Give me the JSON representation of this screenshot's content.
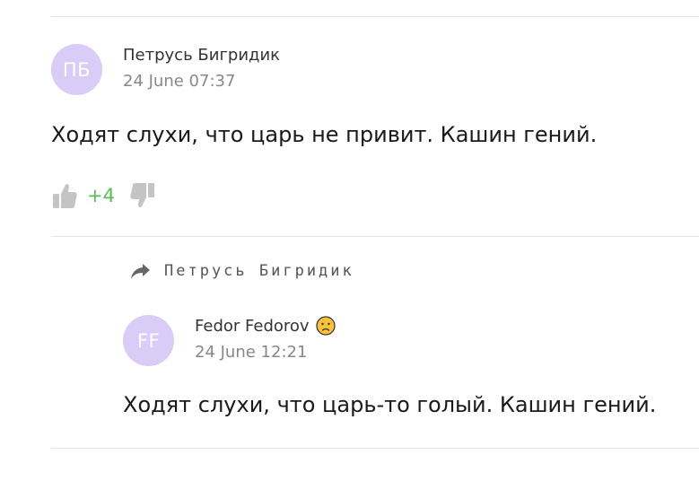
{
  "comments": [
    {
      "avatar_initials": "ПБ",
      "avatar_color": "#d9ccf7",
      "author": "Петрусь Бигридик",
      "timestamp": "24 June 07:37",
      "text": "Ходят слухи, что царь не привит. Кашин гений.",
      "vote_score": "+4",
      "vote_score_color": "#5cb85c"
    }
  ],
  "replies": [
    {
      "reply_to": "Петрусь Бигридик",
      "avatar_initials": "FF",
      "avatar_color": "#d9ccf7",
      "author": "Fedor Fedorov",
      "author_badge_icon": "slightly-frowning-face-emoji-icon",
      "timestamp": "24 June 12:21",
      "text": "Ходят слухи, что царь-то голый. Кашин гений."
    }
  ]
}
